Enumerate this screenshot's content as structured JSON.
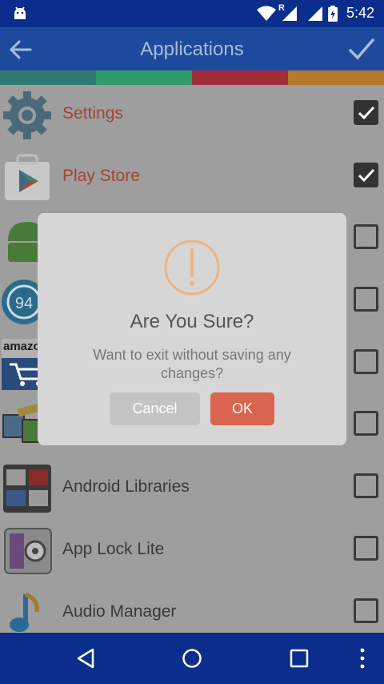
{
  "status_bar": {
    "time": "5:42",
    "roaming": "R"
  },
  "app_bar": {
    "title": "Applications"
  },
  "strip_colors": [
    "#2f7a72",
    "#2f9a6a",
    "#a12c3a",
    "#b27a2a"
  ],
  "apps": [
    {
      "label": "Settings",
      "checked": true,
      "highlight": true,
      "icon": "settings-gear-icon"
    },
    {
      "label": "Play Store",
      "checked": true,
      "highlight": true,
      "icon": "play-store-icon"
    },
    {
      "label": "",
      "checked": false,
      "highlight": false,
      "icon": "android-icon"
    },
    {
      "label": "",
      "checked": false,
      "highlight": false,
      "icon": "circle-94-icon"
    },
    {
      "label": "",
      "checked": false,
      "highlight": false,
      "icon": "amazon-cart-icon"
    },
    {
      "label": "",
      "checked": false,
      "highlight": false,
      "icon": "tools-icon"
    },
    {
      "label": "Android Libraries",
      "checked": false,
      "highlight": false,
      "icon": "libraries-icon"
    },
    {
      "label": "App Lock Lite",
      "checked": false,
      "highlight": false,
      "icon": "safe-lock-icon"
    },
    {
      "label": "Audio Manager",
      "checked": false,
      "highlight": false,
      "icon": "music-note-icon"
    }
  ],
  "dialog": {
    "title": "Are You Sure?",
    "message": "Want to exit without saving any changes?",
    "cancel_label": "Cancel",
    "ok_label": "OK"
  },
  "icon_texts": {
    "amazon": "amazo",
    "ninety_four": "94"
  }
}
